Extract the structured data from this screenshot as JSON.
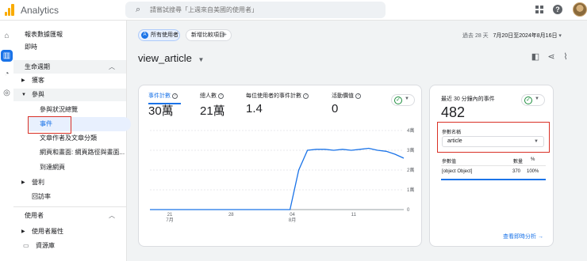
{
  "app": {
    "title": "Analytics"
  },
  "search": {
    "placeholder": "請嘗試搜尋「上週來自美國的使用者」"
  },
  "sidebar": {
    "items": [
      {
        "label": "報表數據匯報"
      },
      {
        "label": "即時"
      }
    ],
    "lifecycle": {
      "label": "生命週期"
    },
    "acquisition": {
      "label": "獲客"
    },
    "engagement": {
      "label": "參與"
    },
    "engagement_items": [
      {
        "label": "參與狀況總覽"
      },
      {
        "label": "事件"
      },
      {
        "label": "文章作者及文章分類"
      },
      {
        "label": "網頁和畫面: 網頁路徑與畫面..."
      },
      {
        "label": "到達網頁"
      }
    ],
    "monetization": {
      "label": "營利"
    },
    "retention": {
      "label": "回訪率"
    },
    "user_section": {
      "label": "使用者"
    },
    "user_attributes": {
      "label": "使用者屬性"
    },
    "library": {
      "label": "資源庫"
    }
  },
  "header": {
    "comparison_chip": {
      "badge": "A",
      "label": "所有使用者"
    },
    "add_comparison": {
      "label": "新增比較項目",
      "icon": "+"
    },
    "date_prefix": "過去 28 天",
    "date_range": "7月20日至2024年8月16日",
    "page_title": "view_article"
  },
  "metrics": [
    {
      "label": "事件計數",
      "value": "30萬"
    },
    {
      "label": "總人數",
      "value": "21萬"
    },
    {
      "label": "每位使用者的事件計數",
      "value": "1.4"
    },
    {
      "label": "活動價值",
      "value": "0"
    }
  ],
  "chart_data": {
    "type": "line",
    "x_tick_labels": [
      "21\n7月",
      "28",
      "04\n8月",
      "11"
    ],
    "y_tick_labels": [
      "4萬",
      "3萬",
      "2萬",
      "1萬",
      "0"
    ],
    "ylim": [
      0,
      40000
    ],
    "series": [
      {
        "values": [
          0,
          0,
          0,
          0,
          0,
          0,
          0,
          0,
          0,
          0,
          0,
          0,
          0,
          0,
          0,
          0,
          0,
          20000,
          30000,
          30500,
          30500,
          30000,
          30500,
          30000,
          30500,
          31000,
          30000,
          29500,
          28000,
          26000
        ],
        "color": "#1a73e8"
      }
    ]
  },
  "realtime": {
    "label": "最近 30 分鐘內的事件",
    "value": "482",
    "param_label": "參數名稱",
    "param_value": "article",
    "table": {
      "headers": [
        "參數值",
        "數量",
        "%"
      ],
      "row": {
        "name": "[object Object]",
        "count": "370",
        "pct": "100%"
      }
    },
    "link": "查看即時分析 →"
  },
  "colors": {
    "accent": "#1a73e8",
    "highlight": "#d93025",
    "success": "#1e8e3e",
    "brand": "#f9ab00"
  }
}
